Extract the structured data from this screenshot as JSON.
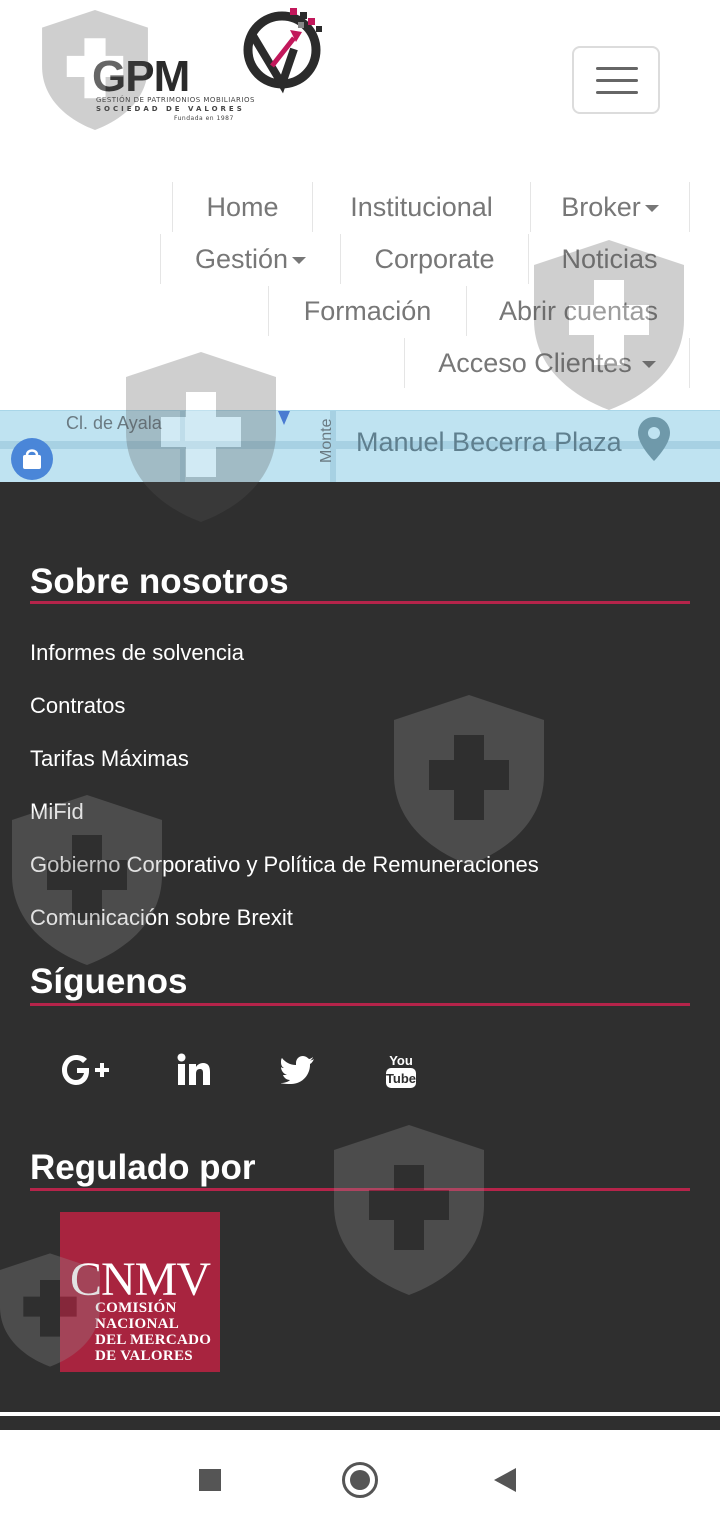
{
  "header": {
    "logo": {
      "text": "GPM",
      "sub1": "GESTIÓN DE PATRIMONIOS MOBILIARIOS",
      "sub2": "SOCIEDAD DE VALORES",
      "sub3": "Fundada en 1987"
    },
    "menu_toggle_label": "menu"
  },
  "nav": {
    "home": "Home",
    "institucional": "Institucional",
    "broker": "Broker",
    "gestion": "Gestión",
    "corporate": "Corporate",
    "noticias": "Noticias",
    "formacion": "Formación",
    "abrir_cuentas": "Abrir cuentas",
    "acceso_clientes": "Acceso Clientes"
  },
  "map": {
    "street1": "Cl. de Ayala",
    "street2": "Monte",
    "place": "Manuel Becerra Plaza"
  },
  "footer": {
    "sobre_nosotros": {
      "title": "Sobre nosotros",
      "links": [
        "Informes de solvencia",
        "Contratos",
        "Tarifas Máximas",
        "MiFid",
        "Gobierno Corporativo y Política de Remuneraciones",
        "Comunicación sobre Brexit"
      ]
    },
    "siguenos": {
      "title": "Síguenos",
      "icons": [
        "google-plus-icon",
        "linkedin-icon",
        "twitter-icon",
        "youtube-icon"
      ]
    },
    "regulado": {
      "title": "Regulado por",
      "cnmv_big": "CNMV",
      "cnmv_lines": [
        "COMISIÓN",
        "NACIONAL",
        "DEL MERCADO",
        "DE VALORES"
      ]
    }
  },
  "colors": {
    "accent": "#b5244a",
    "footer_bg": "#2f2f2f",
    "cnmv_bg": "#a8243f",
    "nav_text": "#777777"
  }
}
